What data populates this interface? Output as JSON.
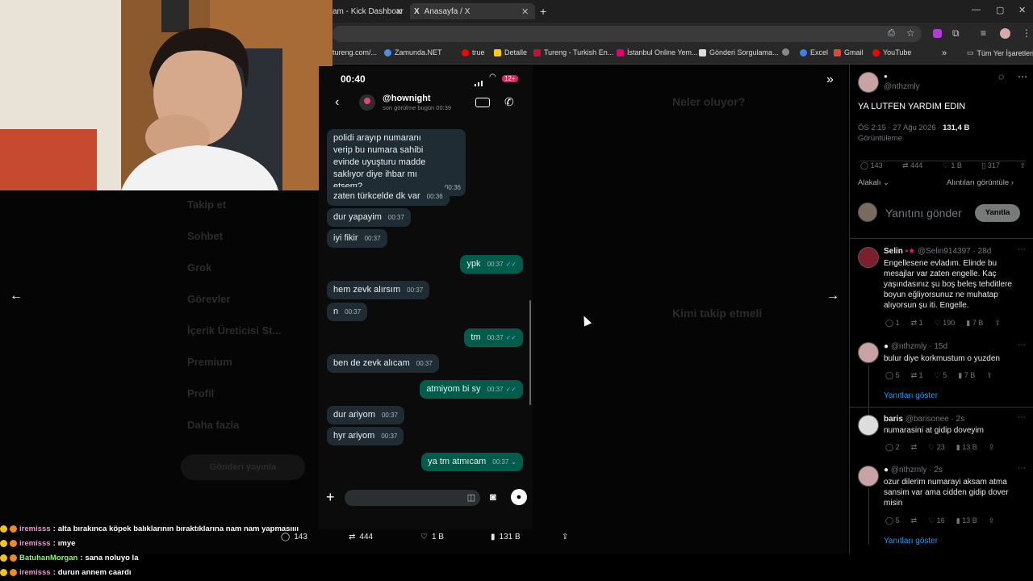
{
  "browser": {
    "tabs": [
      {
        "label": "am - Kick Dashboar"
      },
      {
        "label": "Anasayfa / X"
      }
    ],
    "bookmarks": [
      "tureng.com/...",
      "Zamunda.NET",
      "true",
      "Detalle",
      "Tureng - Turkish En...",
      "İstanbul Online Yem...",
      "Gönderi Sorgulama...",
      "Excel",
      "Gmail",
      "YouTube"
    ],
    "bookmarks_folder": "Tüm Yer İşaretleri"
  },
  "background_page": {
    "nav": [
      "Takip et",
      "Sohbet",
      "Grok",
      "Görevler",
      "İçerik Üreticisi St...",
      "Premium",
      "Profil",
      "Daha fazla"
    ],
    "post_button": "Gönderi yayınla",
    "trending_title": "Neler oluyor?",
    "follow_title": "Kimi takip etmeli"
  },
  "phone": {
    "clock": "00:40",
    "battery_badge": "12+",
    "contact": "@hownight",
    "contact_status": "son görülme bugün 00:39",
    "messages": [
      {
        "text": "polidi arayıp numaranı verip bu numara sahibi evinde uyuşturu madde saklıyor diye ihbar mı etsem?",
        "time": "00:36",
        "dir": "in"
      },
      {
        "text": "zaten türkcelde dk var",
        "time": "00:36",
        "dir": "in"
      },
      {
        "text": "dur yapayim",
        "time": "00:37",
        "dir": "in"
      },
      {
        "text": "iyi fikir",
        "time": "00:37",
        "dir": "in"
      },
      {
        "text": "ypk",
        "time": "00:37",
        "dir": "out"
      },
      {
        "text": "hem zevk alırsım",
        "time": "00:37",
        "dir": "in"
      },
      {
        "text": "n",
        "time": "00:37",
        "dir": "in"
      },
      {
        "text": "tm",
        "time": "00:37",
        "dir": "out"
      },
      {
        "text": "ben de zevk alıcam",
        "time": "00:37",
        "dir": "in"
      },
      {
        "text": "atmiyom bi sy",
        "time": "00:37",
        "dir": "out"
      },
      {
        "text": "dur ariyom",
        "time": "00:37",
        "dir": "in"
      },
      {
        "text": "hyr ariyom",
        "time": "00:37",
        "dir": "in"
      },
      {
        "text": "ya tm atmıcam",
        "time": "00:37",
        "dir": "out"
      }
    ]
  },
  "post_actions": {
    "replies": "143",
    "reposts": "444",
    "likes": "1 B",
    "views": "131 B"
  },
  "xpanel": {
    "author_handle": "@nthzmly",
    "post_text": "YA LUTFEN YARDIM EDIN",
    "post_meta": "ÖS 2:15 · 27 Ağu 2026 · ",
    "post_views": "131,4 B",
    "post_views_label": "Görüntüleme",
    "stats": {
      "replies": "143",
      "reposts": "444",
      "likes": "1 B",
      "bookmarks": "317"
    },
    "sort_label": "Alakalı",
    "quotes_label": "Alıntıları görüntüle",
    "reply_placeholder": "Yanıtını gönder",
    "reply_button": "Yanıtla",
    "replies": [
      {
        "name": "Selin",
        "handle": "@Selin914397 · 28d",
        "text": "Engellesene evladım. Elinde bu mesajlar var zaten engelle. Kaç yaşındasınız şu boş beleş tehditlere boyun eğliyorsunuz ne muhatap alıyorsun şu iti. Engelle.",
        "stats": [
          "1",
          "1",
          "190",
          "7 B"
        ]
      },
      {
        "name": "",
        "handle": "@nthzmly · 15d",
        "text": "bulur diye korkmustum o yuzden",
        "stats": [
          "5",
          "1",
          "5",
          "7 B"
        ],
        "show_replies": "Yanıtları göster"
      },
      {
        "name": "baris",
        "handle": "@barisonee · 2s",
        "text": "numarasini at gidip doveyim",
        "stats": [
          "2",
          "",
          "23",
          "13 B"
        ]
      },
      {
        "name": "",
        "handle": "@nthzmly · 2s",
        "text": "ozur dilerim numarayi aksam atma sansim var ama cidden gidip dover misin",
        "stats": [
          "5",
          "",
          "16",
          "13 B"
        ],
        "show_replies": "Yanıtları göster"
      }
    ]
  },
  "chat": [
    {
      "user": "iremisss",
      "color": "#ff8ad8",
      "message": "alta bırakınca köpek balıklarının bıraktıklarına nam nam yapmasıııı"
    },
    {
      "user": "iremisss",
      "color": "#ff8ad8",
      "message": "ımye"
    },
    {
      "user": "BatuhanMorgan",
      "color": "#7dff5a",
      "message": "sana noluyo la"
    },
    {
      "user": "iremisss",
      "color": "#ff8ad8",
      "message": "durun annem caardı"
    }
  ]
}
